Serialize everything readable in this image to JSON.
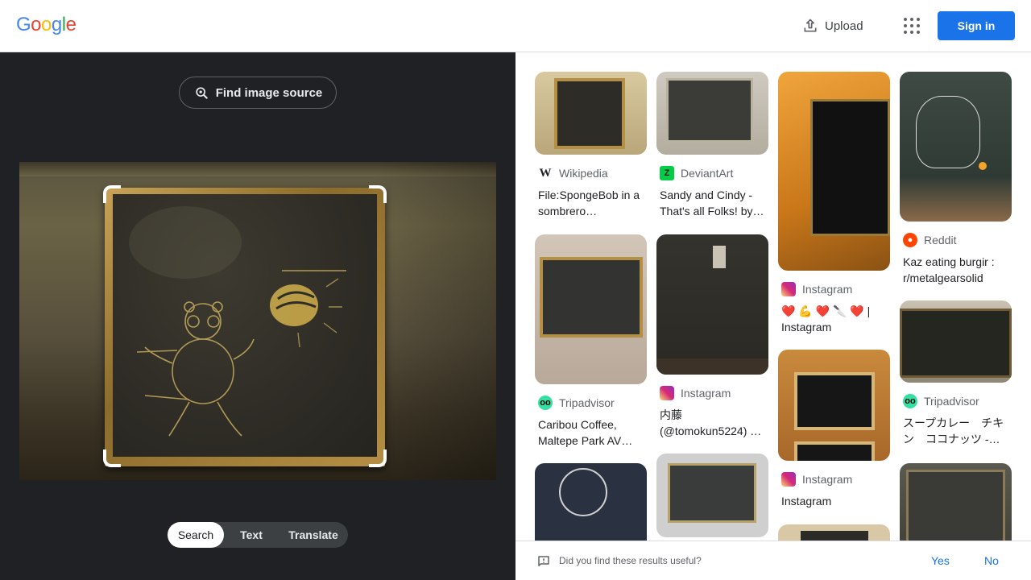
{
  "header": {
    "logo_letters": [
      "G",
      "o",
      "o",
      "g",
      "l",
      "e"
    ],
    "logo_colors": [
      "#4285f4",
      "#ea4335",
      "#fbbc05",
      "#4285f4",
      "#34a853",
      "#ea4335"
    ],
    "upload_label": "Upload",
    "signin_label": "Sign in"
  },
  "left": {
    "find_source_label": "Find image source",
    "modes": [
      "Search",
      "Text",
      "Translate"
    ],
    "active_mode": "Search"
  },
  "results": [
    {
      "source": "Wikipedia",
      "title": "File:SpongeBob in a sombrero…",
      "icon": "wikipedia-icon",
      "icon_color": "#202124"
    },
    {
      "source": "DeviantArt",
      "title": "Sandy and Cindy - That's all Folks! by…",
      "icon": "deviantart-icon",
      "icon_color": "#05cc47"
    },
    {
      "source": "Instagram",
      "title": "❤️ 💪 ❤️ 🔪 ❤️ | Instagram",
      "icon": "instagram-icon",
      "icon_color": "#e1306c"
    },
    {
      "source": "Reddit",
      "title": "Kaz eating burgir : r/metalgearsolid",
      "icon": "reddit-icon",
      "icon_color": "#ff4500"
    },
    {
      "source": "Tripadvisor",
      "title": "Caribou Coffee, Maltepe Park AV…",
      "icon": "tripadvisor-icon",
      "icon_color": "#34e0a1"
    },
    {
      "source": "Instagram",
      "title": "内藤 (@tomokun5224) …",
      "icon": "instagram-icon",
      "icon_color": "#e1306c"
    },
    {
      "source": "Instagram",
      "title": "Instagram",
      "icon": "instagram-icon",
      "icon_color": "#e1306c"
    },
    {
      "source": "Tripadvisor",
      "title": "スープカレー　チキン　ココナッツ -…",
      "icon": "tripadvisor-icon",
      "icon_color": "#34e0a1"
    }
  ],
  "feedback": {
    "question": "Did you find these results useful?",
    "yes_label": "Yes",
    "no_label": "No"
  },
  "colors": {
    "accent": "#1a73e8",
    "dark_panel": "#202124"
  }
}
